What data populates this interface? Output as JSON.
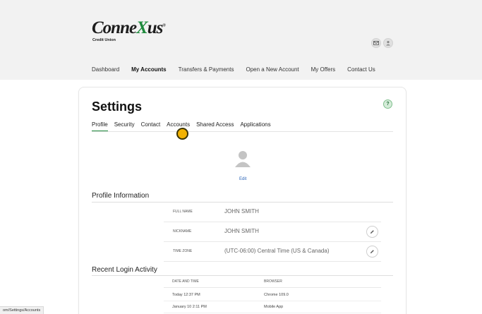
{
  "brand": {
    "wordmark_prefix": "Conne",
    "wordmark_x": "X",
    "wordmark_suffix": "us",
    "trademark": "®",
    "subtitle": "Credit Union",
    "accent_color": "#1e8a3c"
  },
  "header": {
    "icons": [
      "mail-icon",
      "user-icon"
    ]
  },
  "nav": {
    "items": [
      {
        "label": "Dashboard",
        "active": false
      },
      {
        "label": "My Accounts",
        "active": true
      },
      {
        "label": "Transfers & Payments",
        "active": false
      },
      {
        "label": "Open a New Account",
        "active": false
      },
      {
        "label": "My Offers",
        "active": false
      },
      {
        "label": "Contact Us",
        "active": false
      }
    ]
  },
  "settings": {
    "title": "Settings",
    "help_icon": "help-icon",
    "help_glyph": "?",
    "tabs": [
      {
        "label": "Profile",
        "active": true
      },
      {
        "label": "Security",
        "active": false
      },
      {
        "label": "Contact",
        "active": false
      },
      {
        "label": "Accounts",
        "active": false
      },
      {
        "label": "Shared Access",
        "active": false
      },
      {
        "label": "Applications",
        "active": false
      }
    ],
    "avatar_edit": "Edit"
  },
  "profile": {
    "section_title": "Profile Information",
    "rows": [
      {
        "label": "FULL NAME",
        "value": "JOHN SMITH",
        "editable": false
      },
      {
        "label": "NICKNAME",
        "value": "JOHN SMITH",
        "editable": true
      },
      {
        "label": "TIME ZONE",
        "value": "(UTC-06:00) Central Time (US & Canada)",
        "editable": true
      }
    ]
  },
  "login_activity": {
    "section_title": "Recent Login Activity",
    "headers": [
      "DATE AND TIME",
      "BROWSER"
    ],
    "rows": [
      {
        "date": "Today 12:37 PM",
        "browser": "Chrome 109.0"
      },
      {
        "date": "January 10 2:11 PM",
        "browser": "Mobile App"
      }
    ]
  },
  "status_bar": {
    "url": "om/Settings/Accounts"
  }
}
